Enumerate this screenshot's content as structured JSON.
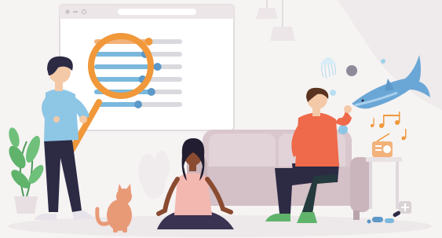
{
  "illustration": {
    "browser_window": {
      "title_bar_controls": [
        "close-icon",
        "minimize-icon",
        "maximize-icon"
      ],
      "bars": [
        {
          "fill": 0.62,
          "color": "#f2b27a"
        },
        {
          "fill": 0.58,
          "color": "#7ab8dd"
        },
        {
          "fill": 0.72,
          "color": "#7ab8dd"
        },
        {
          "fill": 0.55,
          "color": "#7ab8dd"
        },
        {
          "fill": 0.65,
          "color": "#7ab8dd"
        },
        {
          "fill": 0.5,
          "color": "#7ab8dd"
        }
      ]
    },
    "colors": {
      "background": "#f4f1f1",
      "window_frame": "#e7e1e4",
      "magnifier": "#f0983a",
      "sofa": "#d9c7cd",
      "shirt_blue": "#8ec6e6",
      "shirt_orange": "#ef6a4a",
      "pants_dark": "#2d2a44",
      "skin_dark": "#8a4b30",
      "cat": "#e89a77",
      "fish": "#6aa7d6",
      "plant": "#5fb36b",
      "music": "#f0983a"
    },
    "elements": [
      "browser-window",
      "magnifying-glass-icon",
      "man-with-magnifier",
      "meditating-woman",
      "man-on-sofa",
      "sofa",
      "cat",
      "jellyfish",
      "shark",
      "radio-icon",
      "music-note-icon",
      "pills-icon",
      "plant",
      "lamp-icon"
    ]
  }
}
